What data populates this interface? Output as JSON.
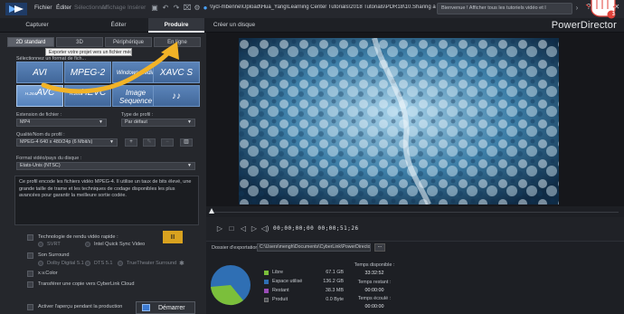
{
  "titlebar": {
    "menu": [
      {
        "label": "Fichier",
        "enabled": true
      },
      {
        "label": "Éditer",
        "enabled": true
      },
      {
        "label": "Sélectionner",
        "enabled": false
      },
      {
        "label": "Affichage",
        "enabled": false
      },
      {
        "label": "Insérer",
        "enabled": false
      }
    ],
    "path": "\\\\ycl-mbenne\\Upload\\Hua_Yang\\Learning Center Tutorials\\2018 Tutorials\\PDR18\\10.Sharing and exporting your",
    "search_text": "Bienvenue ! Afficher tous les tutoriels vidéo et l",
    "window_buttons": [
      "?",
      "_",
      "⧉",
      "✕"
    ]
  },
  "modes": {
    "tabs": [
      "Capturer",
      "Éditer",
      "Produire",
      "Créer un disque"
    ],
    "active": "Produire",
    "app_name": "PowerDirector"
  },
  "left": {
    "subtabs": [
      "2D standard",
      "3D",
      "Périphérique",
      "En ligne"
    ],
    "active_subtab": "2D standard",
    "tooltip": "Exporter votre projet vers un fichier média",
    "select_label": "Sélectionnez un format de fich...",
    "formats": [
      {
        "label": "AVI",
        "sub": ""
      },
      {
        "label": "MPEG-2",
        "sub": ""
      },
      {
        "label": "Windows Media",
        "sub": ""
      },
      {
        "label": "XAVC S",
        "sub": ""
      },
      {
        "label": "AVC",
        "sub": "H.264"
      },
      {
        "label": "HEVC",
        "sub": "H.265"
      },
      {
        "label": "Image",
        "sub": "Sequence"
      },
      {
        "label": "♪♪",
        "sub": ""
      }
    ],
    "selected_format": "AVC",
    "extension_label": "Extension de fichier :",
    "extension_value": "MP4",
    "profile_type_label": "Type de profil :",
    "profile_type_value": "Par défaut",
    "quality_label": "Qualité/Nom du profil :",
    "quality_value": "MPEG-4 640 x 480/24p (6 Mbit/s)",
    "tv_format_label": "Format vidéo/pays du disque :",
    "tv_format_value": "États-Unis (NTSC)",
    "description": "Ce profil encode les fichiers vidéo MPEG-4. Il utilise un taux de bits élevé, une grande taille de trame et les techniques de codage disponibles les plus avancées pour garantir la meilleure sortie codée.",
    "fast_render_label": "Technologie de rendu vidéo rapide :",
    "svrt_label": "SVRT",
    "intel_label": "Intel Quick Sync Video",
    "surround_label": "Son Surround",
    "dolby_label": "Dolby Digital 5.1",
    "dts_label": "DTS 5.1",
    "truetheater_label": "TrueTheater Surround",
    "xvcolor_label": "x.v.Color",
    "cloud_label": "Transférer une copie vers CyberLink Cloud",
    "preview_toggle_label": "Activer l'aperçu pendant la production",
    "start_label": "Démarrer"
  },
  "preview": {
    "timecode": "00;00;00;00  00;00;51;26"
  },
  "export": {
    "folder_label": "Dossier d'exportation :",
    "folder_path": "C:\\Users\\mengh\\Documents\\CyberLink\\PowerDirector\\1",
    "browse_label": "...",
    "disk": [
      {
        "label": "Libre",
        "value": "67.1 GB",
        "color": "#7bbf3b"
      },
      {
        "label": "Espace utilisé",
        "value": "136.2 GB",
        "color": "#2f6fb4"
      },
      {
        "label": "Restant",
        "value": "38.3 MB",
        "color": "#9b4db8"
      },
      {
        "label": "Produit",
        "value": "0.0 Byte",
        "color": "#4a4e55"
      }
    ],
    "time_available_label": "Temps disponible :",
    "time_available": "33:32:52",
    "time_remaining_label": "Temps restant :",
    "time_remaining": "00:00:00",
    "time_elapsed_label": "Temps écoulé :",
    "time_elapsed": "00:00:00"
  },
  "colors": {
    "accent_arrow": "#f2b327",
    "format_button": "#4f78ad"
  },
  "overlay": {
    "step_number": "3"
  }
}
